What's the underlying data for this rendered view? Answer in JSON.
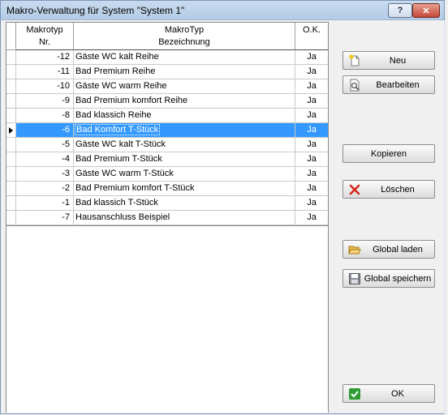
{
  "window": {
    "title": "Makro-Verwaltung für System \"System 1\"",
    "help_label": "?",
    "close_label": "✕"
  },
  "table": {
    "headers": {
      "nr": [
        "Makrotyp",
        "Nr."
      ],
      "bez": [
        "MakroTyp",
        "Bezeichnung"
      ],
      "ok": [
        "O.K."
      ]
    },
    "selected_index": 5,
    "rows": [
      {
        "nr": "-12",
        "bez": "Gäste WC kalt Reihe",
        "ok": "Ja"
      },
      {
        "nr": "-11",
        "bez": "Bad Premium Reihe",
        "ok": "Ja"
      },
      {
        "nr": "-10",
        "bez": "Gäste WC warm Reihe",
        "ok": "Ja"
      },
      {
        "nr": "-9",
        "bez": "Bad Premium komfort Reihe",
        "ok": "Ja"
      },
      {
        "nr": "-8",
        "bez": "Bad klassich Reihe",
        "ok": "Ja"
      },
      {
        "nr": "-6",
        "bez": "Bad Komfort T-Stück",
        "ok": "Ja"
      },
      {
        "nr": "-5",
        "bez": "Gäste WC kalt T-Stück",
        "ok": "Ja"
      },
      {
        "nr": "-4",
        "bez": "Bad Premium T-Stück",
        "ok": "Ja"
      },
      {
        "nr": "-3",
        "bez": "Gäste WC warm T-Stück",
        "ok": "Ja"
      },
      {
        "nr": "-2",
        "bez": "Bad Premium komfort T-Stück",
        "ok": "Ja"
      },
      {
        "nr": "-1",
        "bez": "Bad klassich T-Stück",
        "ok": "Ja"
      },
      {
        "nr": "-7",
        "bez": "Hausanschluss Beispiel",
        "ok": "Ja"
      }
    ]
  },
  "buttons": {
    "neu": {
      "label": "Neu",
      "icon": "new-document-icon"
    },
    "bearbeiten": {
      "label": "Bearbeiten",
      "icon": "edit-document-icon"
    },
    "kopieren": {
      "label": "Kopieren"
    },
    "loeschen": {
      "label": "Löschen",
      "icon": "red-x-icon"
    },
    "global_laden": {
      "label": "Global laden",
      "icon": "open-folder-icon"
    },
    "global_speichern": {
      "label": "Global speichern",
      "icon": "save-disk-icon"
    },
    "ok": {
      "label": "OK",
      "icon": "green-check-icon"
    }
  },
  "colors": {
    "selection": "#3399ff",
    "delete_icon": "#d9261c",
    "ok_icon": "#2e9b33"
  }
}
